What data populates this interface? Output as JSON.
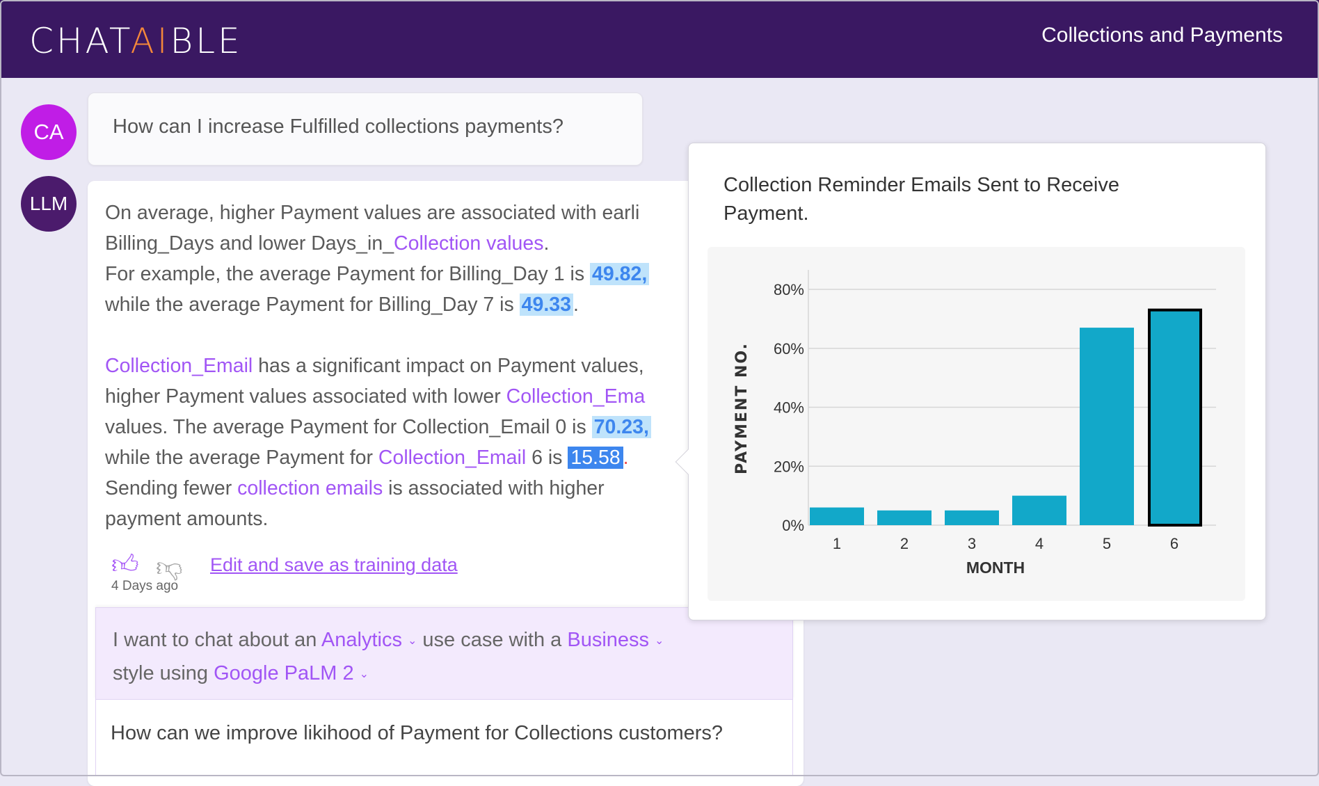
{
  "header": {
    "logo": {
      "pre": "CHAT",
      "ai": "AI",
      "post": "BLE"
    },
    "title": "Collections and Payments"
  },
  "user": {
    "avatar": "CA",
    "message": "How can I increase Fulfilled collections payments?"
  },
  "llm": {
    "avatar": "LLM",
    "lines": [
      [
        {
          "t": "On average, higher Payment values are associated with earli"
        }
      ],
      [
        {
          "t": "Billing_Days and lower Days_in_"
        },
        {
          "t": "Collection values",
          "s": "lk"
        },
        {
          "t": "."
        }
      ],
      [
        {
          "t": "For example, the average Payment for Billing_Day 1 is "
        },
        {
          "t": "49.82,",
          "s": "hl"
        }
      ],
      [
        {
          "t": "while the average Payment for Billing_Day 7 is "
        },
        {
          "t": "49.33",
          "s": "hl"
        },
        {
          "t": "."
        }
      ],
      [],
      [
        {
          "t": "Collection_Email",
          "s": "lk"
        },
        {
          "t": " has a significant impact on Payment values,"
        }
      ],
      [
        {
          "t": "higher Payment values associated with lower "
        },
        {
          "t": "Collection_Ema",
          "s": "lk"
        }
      ],
      [
        {
          "t": "values. The average Payment for Collection_Email 0 is "
        },
        {
          "t": "70.23,",
          "s": "hl"
        }
      ],
      [
        {
          "t": "while the average Payment for "
        },
        {
          "t": "Collection_Email",
          "s": "lk"
        },
        {
          "t": " 6 is "
        },
        {
          "t": "15.58",
          "s": "sel"
        },
        {
          "t": ".",
          "s": "red"
        }
      ],
      [
        {
          "t": "Sending fewer "
        },
        {
          "t": "collection emails",
          "s": "lk"
        },
        {
          "t": " is associated with higher"
        }
      ],
      [
        {
          "t": "payment amounts."
        }
      ]
    ],
    "feedback": {
      "like_icon": "thumbs-up",
      "dislike_icon": "thumbs-down",
      "edit_link": "Edit and save as training data",
      "time": "4 Days ago"
    }
  },
  "settings": {
    "p1": "I want to chat about an",
    "usecase": "Analytics",
    "p2": "use case with a",
    "style": "Business",
    "p3": "style using",
    "model": "Google PaLM 2"
  },
  "input": {
    "value": "How can we improve likihood of Payment for Collections customers?"
  },
  "popup": {
    "title": "Collection Reminder Emails Sent to Receive Payment."
  },
  "chart_data": {
    "type": "bar",
    "title": "Collection Reminder Emails Sent to Receive Payment.",
    "xlabel": "MONTH",
    "ylabel": "PAYMENT NO.",
    "categories": [
      "1",
      "2",
      "3",
      "4",
      "5",
      "6"
    ],
    "values": [
      6,
      5,
      5,
      10,
      67,
      73
    ],
    "yticks": [
      "0%",
      "20%",
      "40%",
      "60%",
      "80%"
    ],
    "ylim": [
      0,
      80
    ],
    "grid": true,
    "highlighted": "6",
    "colors": {
      "bar": "#12a8c9",
      "highlight_border": "#000000"
    }
  }
}
